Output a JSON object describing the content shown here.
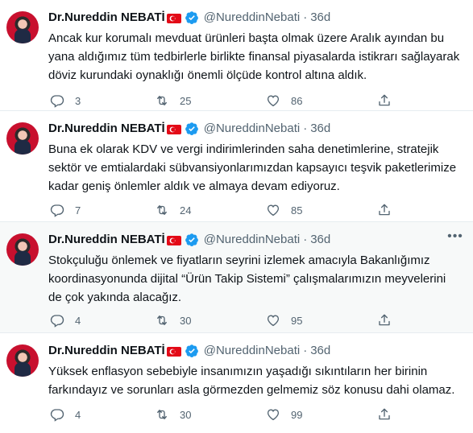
{
  "tweets": [
    {
      "name": "Dr.Nureddin NEBATİ",
      "handle": "@NureddinNebati",
      "separator": "·",
      "time": "36d",
      "text": "Ancak kur korumalı mevduat ürünleri başta olmak üzere Aralık ayından bu yana aldığımız tüm tedbirlerle birlikte finansal piyasalarda istikrarı sağlayarak döviz kurundaki oynaklığı önemli ölçüde kontrol altına aldık.",
      "replies": "3",
      "retweets": "25",
      "likes": "86"
    },
    {
      "name": "Dr.Nureddin NEBATİ",
      "handle": "@NureddinNebati",
      "separator": "·",
      "time": "36d",
      "text": "Buna ek olarak KDV ve vergi indirimlerinden saha denetimlerine, stratejik sektör ve emtialardaki sübvansiyonlarımızdan kapsayıcı teşvik paketlerimize kadar geniş önlemler aldık ve almaya devam ediyoruz.",
      "replies": "7",
      "retweets": "24",
      "likes": "85"
    },
    {
      "name": "Dr.Nureddin NEBATİ",
      "handle": "@NureddinNebati",
      "separator": "·",
      "time": "36d",
      "text": "Stokçuluğu önlemek ve fiyatların seyrini izlemek amacıyla Bakanlığımız koordinasyonunda dijital “Ürün Takip Sistemi” çalışmalarımızın meyvelerini de çok yakında alacağız.",
      "replies": "4",
      "retweets": "30",
      "likes": "95"
    },
    {
      "name": "Dr.Nureddin NEBATİ",
      "handle": "@NureddinNebati",
      "separator": "·",
      "time": "36d",
      "text": "Yüksek enflasyon sebebiyle insanımızın yaşadığı sıkıntıların her birinin farkındayız ve sorunları asla görmezden gelmemiz söz konusu dahi olamaz.",
      "replies": "4",
      "retweets": "30",
      "likes": "99"
    }
  ],
  "icons": {
    "reply": "reply-icon",
    "retweet": "retweet-icon",
    "like": "heart-icon",
    "share": "share-icon",
    "verified": "verified-badge-icon",
    "flag": "turkey-flag-icon"
  },
  "colors": {
    "text": "#0f1419",
    "secondary": "#536471",
    "verified": "#1d9bf0",
    "divider": "#e6ecf0",
    "hover_bg": "#f7f9f9"
  }
}
